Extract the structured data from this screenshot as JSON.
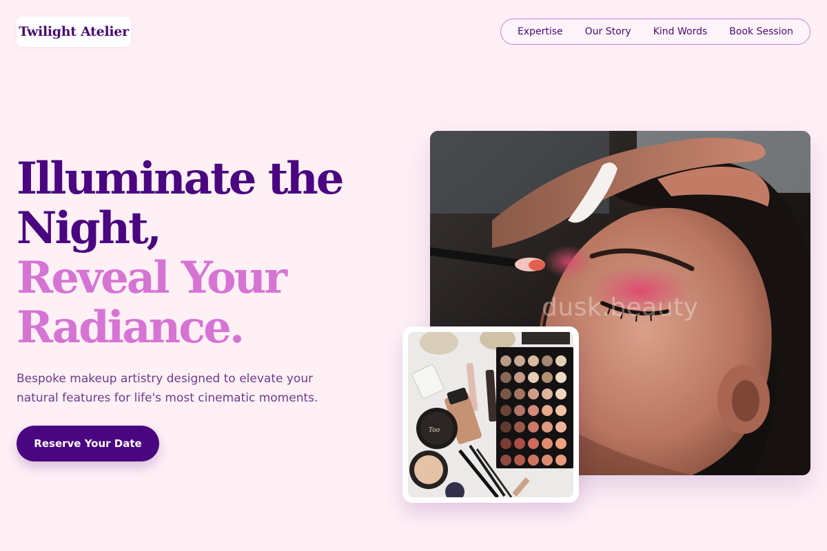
{
  "brand": {
    "name": "Twilight Atelier"
  },
  "nav": {
    "items": [
      {
        "label": "Expertise"
      },
      {
        "label": "Our Story"
      },
      {
        "label": "Kind Words"
      },
      {
        "label": "Book Session"
      }
    ]
  },
  "hero": {
    "headline_line1": "Illuminate the",
    "headline_line2": "Night,",
    "headline_line3": "Reveal Your",
    "headline_line4": "Radiance.",
    "subcopy": "Bespoke makeup artistry designed to elevate your natural features for life's most cinematic moments.",
    "cta_label": "Reserve Your Date",
    "image_watermark": "dusk.beauty",
    "image_alt": "Makeup artist applying pink eyeshadow to a client",
    "product_image_alt": "Flat lay of makeup products and eyeshadow palette"
  },
  "colors": {
    "background": "#fff0f6",
    "primary": "#4a0580",
    "accent_pink": "#d674d4",
    "body_text": "#6d3a8c"
  }
}
